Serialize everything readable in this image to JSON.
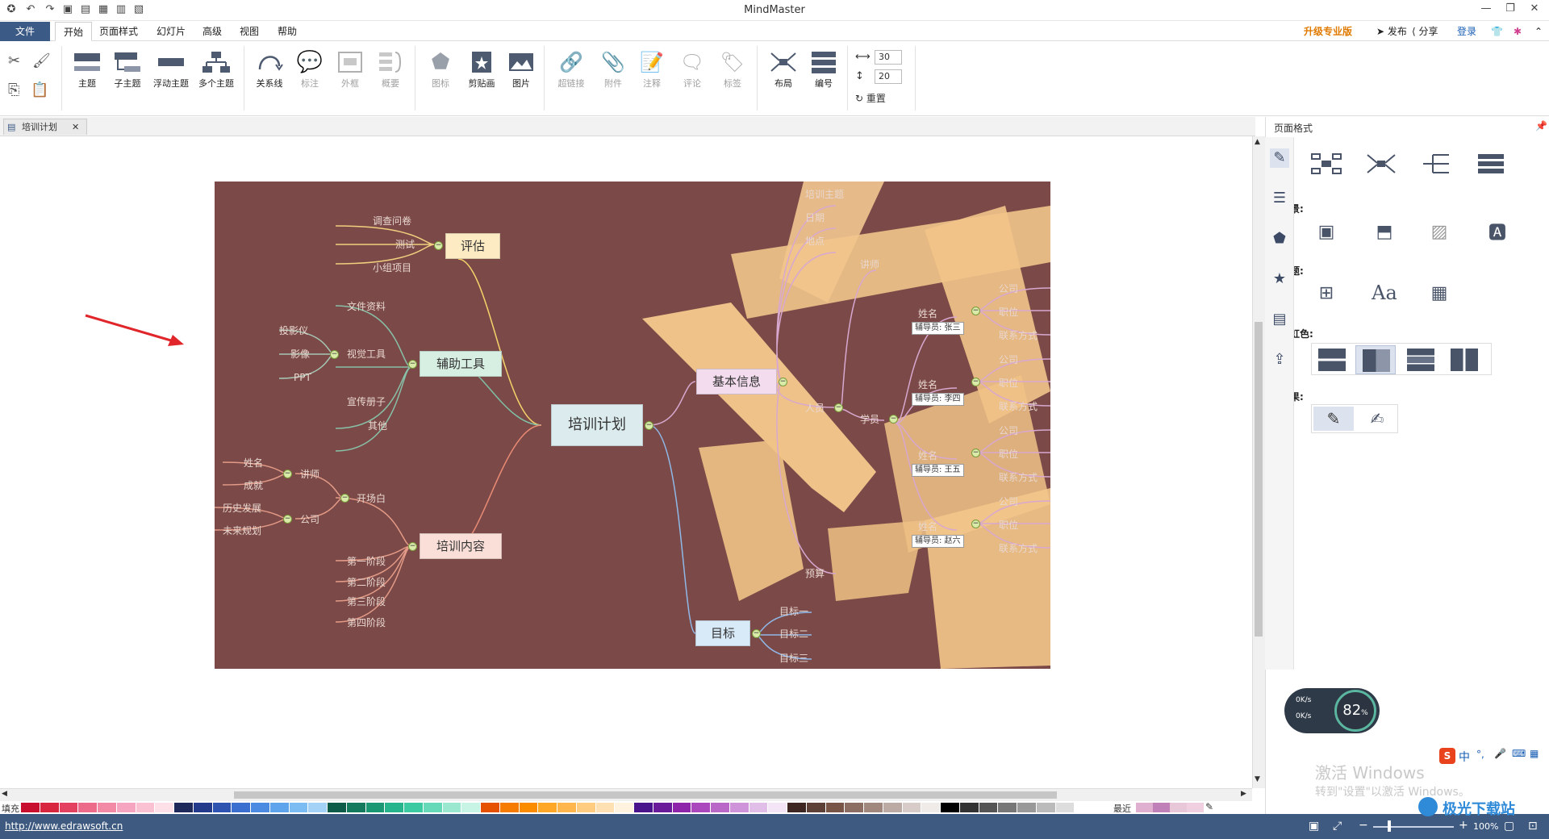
{
  "app": {
    "title": "MindMaster"
  },
  "window": {
    "minimize": "—",
    "restore": "❐",
    "close": "✕"
  },
  "menu": {
    "file": "文件",
    "tabs": [
      "开始",
      "页面样式",
      "幻灯片",
      "高级",
      "视图",
      "帮助"
    ],
    "right": {
      "upgrade": "升级专业版",
      "publish": "发布",
      "share": "分享",
      "login": "登录"
    }
  },
  "ribbon": {
    "topic": "主题",
    "subtopic": "子主题",
    "floating": "浮动主题",
    "multi": "多个主题",
    "relation": "关系线",
    "callout": "标注",
    "boundary": "外框",
    "summary": "概要",
    "icon": "图标",
    "clipart": "剪贴画",
    "picture": "图片",
    "hyperlink": "超链接",
    "attachment": "附件",
    "note": "注释",
    "comment": "评论",
    "tag": "标签",
    "layout": "布局",
    "numbering": "编号",
    "spacing_h": "30",
    "spacing_v": "20",
    "reset": "重置"
  },
  "document_tab": {
    "title": "培训计划",
    "close": "✕"
  },
  "mindmap": {
    "root": "培训计划",
    "eval": {
      "label": "评估",
      "children": [
        "调查问卷",
        "测试",
        "小组项目"
      ]
    },
    "tools": {
      "label": "辅助工具",
      "children": [
        "文件资料",
        "视觉工具",
        "宣传册子",
        "其他"
      ],
      "visual_children": [
        "投影仪",
        "影像",
        "PPT"
      ]
    },
    "content": {
      "label": "培训内容",
      "children": [
        "开场白",
        "第一阶段",
        "第二阶段",
        "第三阶段",
        "第四阶段"
      ],
      "opening": [
        "讲师",
        "公司"
      ],
      "lecturer": [
        "姓名",
        "成就"
      ],
      "company": [
        "历史发展",
        "未来规划"
      ]
    },
    "basic": {
      "label": "基本信息",
      "children": [
        "培训主题",
        "日期",
        "地点",
        "人员",
        "预算"
      ],
      "people": [
        "讲师",
        "学员"
      ]
    },
    "students": [
      {
        "name": "姓名",
        "tag": "辅导员: 张三",
        "items": [
          "公司",
          "职位",
          "联系方式"
        ]
      },
      {
        "name": "姓名",
        "tag": "辅导员: 李四",
        "items": [
          "公司",
          "职位",
          "联系方式"
        ]
      },
      {
        "name": "姓名",
        "tag": "辅导员: 王五",
        "items": [
          "公司",
          "职位",
          "联系方式"
        ]
      },
      {
        "name": "姓名",
        "tag": "辅导员: 赵六",
        "items": [
          "公司",
          "职位",
          "联系方式"
        ]
      }
    ],
    "goal": {
      "label": "目标",
      "children": [
        "目标一",
        "目标二",
        "目标三"
      ]
    }
  },
  "sidebar": {
    "title": "页面格式",
    "background": "背景:",
    "theme": "主题:",
    "rainbow": "彩虹色:",
    "effect": "效果:"
  },
  "palette": {
    "fill": "填充",
    "recent": "最近"
  },
  "status": {
    "url": "http://www.edrawsoft.cn",
    "zoom": "100%"
  },
  "widget": {
    "percent": "82",
    "up": "0K/s",
    "down": "0K/s"
  },
  "ime": {
    "mode": "中"
  },
  "watermark": {
    "line1": "激活 Windows",
    "line2": "转到\"设置\"以激活 Windows。"
  },
  "logo": {
    "text": "极光下载站"
  },
  "colors": {
    "accent": "#3c5a86",
    "mindmap_bg": "#7b4a48",
    "arrow": "#e0262a"
  }
}
